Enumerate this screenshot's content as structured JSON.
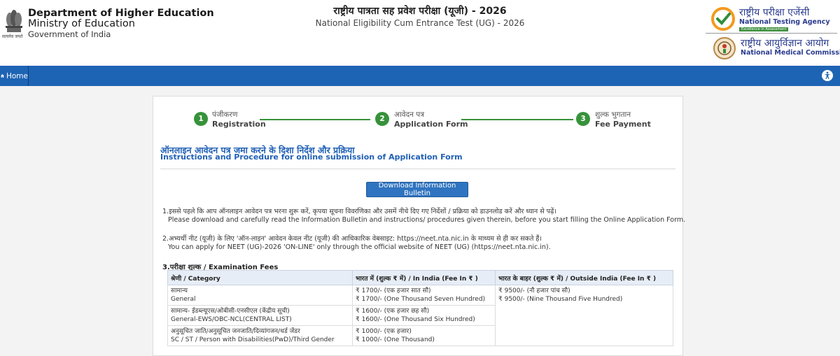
{
  "header": {
    "emblem_caption": "सत्यमेव जयते",
    "department": "Department of Higher Education",
    "ministry": "Ministry of Education",
    "government": "Government of India",
    "exam_title_hi": "राष्ट्रीय पात्रता सह प्रवेश परीक्षा (यूजी) - 2026",
    "exam_title_en": "National Eligibility Cum Entrance Test (UG) - 2026",
    "nta_name_hi": "राष्ट्रीय परीक्षा एजेंसी",
    "nta_name_en": "National Testing Agency",
    "nta_tagline": "Excellence in Assessment",
    "nmc_name_hi": "राष्ट्रीय आयुर्विज्ञान आयोग",
    "nmc_name_en": "National Medical Commission"
  },
  "nav": {
    "home_label": "Home"
  },
  "steps": [
    {
      "number": "1",
      "label_hi": "पंजीकरण",
      "label_en": "Registration"
    },
    {
      "number": "2",
      "label_hi": "आवेदन पत्र",
      "label_en": "Application Form"
    },
    {
      "number": "3",
      "label_hi": "शुल्क भुगतान",
      "label_en": "Fee Payment"
    }
  ],
  "section": {
    "title_hi": "ऑनलाइन आवेदन पत्र जमा करने के दिशा निर्देश और प्रक्रिया",
    "title_en": "Instructions and Procedure for online submission of Application Form",
    "download_button": "Download Information Bulletin"
  },
  "instructions": [
    {
      "hi": "1.इससे पहले कि आप ऑनलाइन आवेदन पत्र भरना शुरू करें, कृपया सूचना विवरणिका और उसमें नीचे दिए गए निर्देशों / प्रक्रिया को डाउनलोड करें और ध्यान से पढ़ें।",
      "en": "Please download and carefully read the Information Bulletin and instructions/ procedures given therein, before you start filling the Online Application Form."
    },
    {
      "hi": "2.अभ्यर्थी नीट (यूजी) के लिए 'ऑन-लाइन' आवेदन केवल नीट (यूजी) की आधिकारिक वेबसाइट: https://neet.nta.nic.in के माध्यम से ही कर सकते हैं।",
      "en": "You can apply for NEET (UG)-2026 'ON-LINE' only through the official website of NEET (UG) (https://neet.nta.nic.in)."
    }
  ],
  "fees": {
    "heading": "3.परीक्षा शुल्क / Examination Fees",
    "columns": [
      "श्रेणी / Category",
      "भारत में (शुल्क ₹ में) / In India (Fee In ₹ )",
      "भारत के बाहर (शुल्क ₹ में) / Outside India (Fee In ₹ )"
    ],
    "outside_india": [
      "₹ 9500/- (नौ हजार पांच सौ)",
      "₹ 9500/- (Nine Thousand Five Hundred)"
    ],
    "rows": [
      {
        "category_hi": "सामान्य",
        "category_en": "General",
        "fee_hi": "₹ 1700/- (एक हजार सात सौ)",
        "fee_en": "₹ 1700/- (One Thousand Seven Hundred)"
      },
      {
        "category_hi": "सामान्य- ईडब्ल्यूएस/ओबीसी-एनसीएल (केंद्रीय सूची)",
        "category_en": "General-EWS/OBC-NCL(CENTRAL LIST)",
        "fee_hi": "₹ 1600/- (एक हजार छह सौ)",
        "fee_en": "₹ 1600/- (One Thousand Six Hundred)"
      },
      {
        "category_hi": "अनुसूचित जाति/अनुसूचित जनजाति/दिव्यांगजन/थर्ड जेंडर",
        "category_en": "SC / ST / Person with Disabilities(PwD)/Third Gender",
        "fee_hi": "₹ 1000/- (एक हजार)",
        "fee_en": "₹ 1000/- (One Thousand)"
      }
    ]
  },
  "colors": {
    "nav_blue": "#1e64b4",
    "step_green": "#37923b",
    "title_blue": "#2060b5",
    "button_blue": "#2f74c0"
  }
}
